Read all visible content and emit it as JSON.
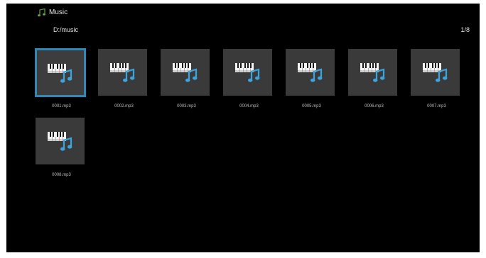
{
  "app": {
    "title": "Music",
    "icon": "music-note-icon"
  },
  "navigation": {
    "path": "D:/music",
    "page_counter": "1/8"
  },
  "colors": {
    "background": "#000000",
    "selected_border": "#2f88b7",
    "tile_background": "#3a3a3a",
    "note_blue": "#3aa4de"
  },
  "files": [
    {
      "name": "0001.mp3",
      "selected": true,
      "icon": "piano-music-file-icon"
    },
    {
      "name": "0002.mp3",
      "selected": false,
      "icon": "piano-music-file-icon"
    },
    {
      "name": "0003.mp3",
      "selected": false,
      "icon": "piano-music-file-icon"
    },
    {
      "name": "0004.mp3",
      "selected": false,
      "icon": "piano-music-file-icon"
    },
    {
      "name": "0005.mp3",
      "selected": false,
      "icon": "piano-music-file-icon"
    },
    {
      "name": "0006.mp3",
      "selected": false,
      "icon": "piano-music-file-icon"
    },
    {
      "name": "0007.mp3",
      "selected": false,
      "icon": "piano-music-file-icon"
    },
    {
      "name": "0008.mp3",
      "selected": false,
      "icon": "piano-music-file-icon"
    }
  ]
}
